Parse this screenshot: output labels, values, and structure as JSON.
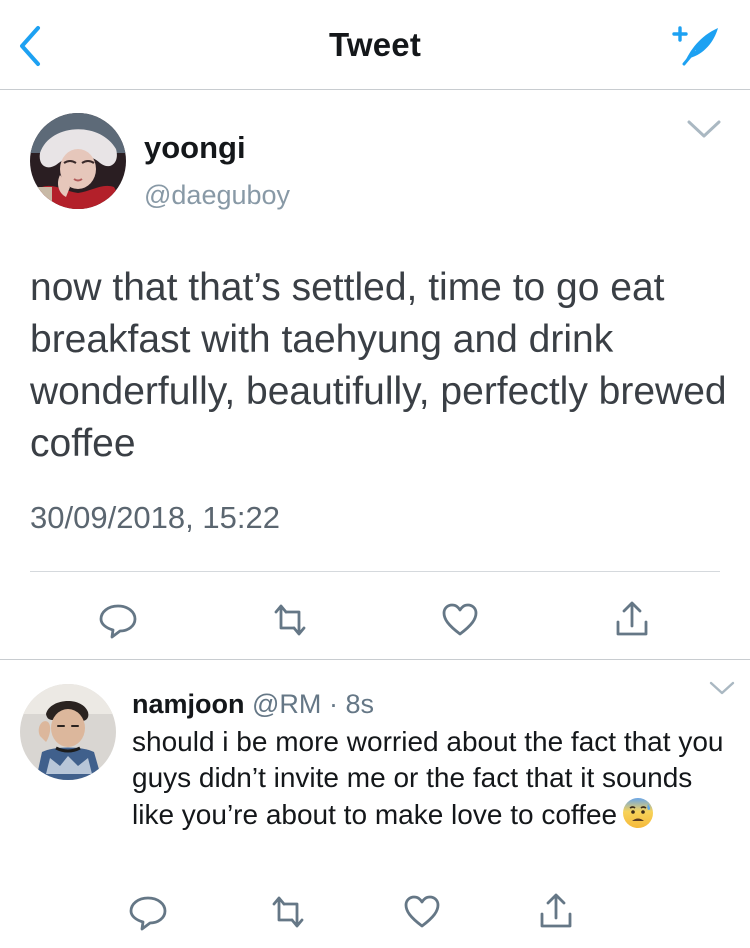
{
  "header": {
    "title": "Tweet",
    "back_icon": "chevron-left-icon",
    "compose_icon": "compose-tweet-icon"
  },
  "tweet": {
    "author_name": "yoongi",
    "author_handle": "@daeguboy",
    "text": "now that that’s settled, time to go eat breakfast with taehyung and drink wonderfully, beautifully, perfectly brewed coffee",
    "timestamp": "30/09/2018, 15:22",
    "actions": [
      "reply-icon",
      "retweet-icon",
      "like-icon",
      "share-icon"
    ]
  },
  "reply": {
    "author_name": "namjoon",
    "author_handle": "@RM",
    "separator": "·",
    "time_ago": "8s",
    "text": "should i be more worried about the fact that you guys didn’t invite me or the fact that it sounds like you’re about to make love to coffee",
    "emoji": "anxious-face-with-sweat-icon",
    "actions": [
      "reply-icon",
      "retweet-icon",
      "like-icon",
      "share-icon"
    ]
  },
  "colors": {
    "accent": "#1da1f2",
    "icon_gray": "#657786",
    "handle_gray": "#8899a6"
  }
}
